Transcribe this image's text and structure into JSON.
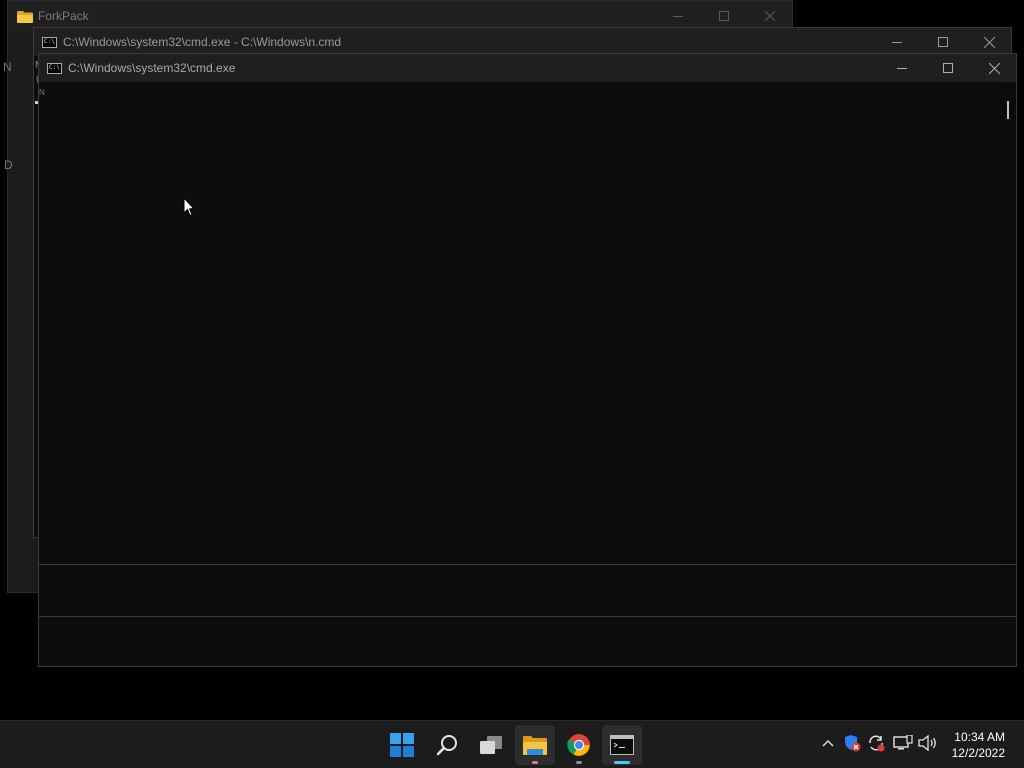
{
  "explorer": {
    "title": "ForkPack",
    "side_chars": [
      "N",
      "D"
    ]
  },
  "cmd_back": {
    "title": "C:\\Windows\\system32\\cmd.exe - C:\\Windows\\n.cmd",
    "partial_text": [
      "M",
      "("
    ]
  },
  "cmd_front": {
    "title": "C:\\Windows\\system32\\cmd.exe",
    "partial_text": "N"
  },
  "icons": {
    "folder": "folder-icon",
    "cmd": "cmd-icon",
    "start": "windows-start-icon",
    "search": "search-icon",
    "task_view": "task-view-icon",
    "file_explorer": "file-explorer-icon",
    "chrome": "chrome-icon",
    "terminal": "terminal-icon",
    "chevron": "chevron-up-icon",
    "security": "windows-security-icon",
    "sync": "sync-icon",
    "network": "network-icon",
    "volume": "volume-icon"
  },
  "taskbar": {
    "time": "10:34 AM",
    "date": "12/2/2022"
  },
  "colors": {
    "accent": "#0078d4",
    "indicator_active": "#4cc2ff",
    "indicator_explorer": "#e07b86"
  }
}
